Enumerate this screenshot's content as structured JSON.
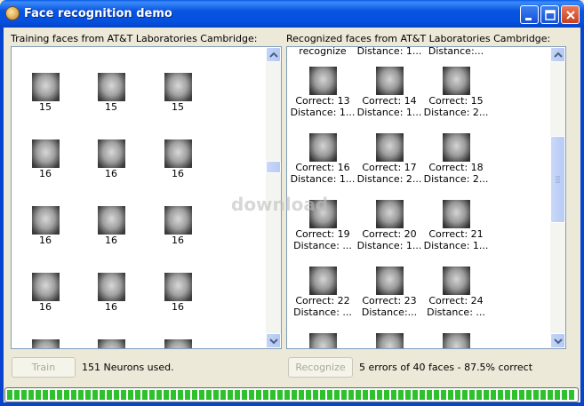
{
  "window": {
    "title": "Face recognition demo"
  },
  "training": {
    "label": "Training faces from AT&T Laboratories Cambridge:",
    "rows": [
      [
        "15",
        "15",
        "15"
      ],
      [
        "16",
        "16",
        "16"
      ],
      [
        "16",
        "16",
        "16"
      ],
      [
        "16",
        "16",
        "16"
      ],
      [
        "",
        "",
        ""
      ]
    ]
  },
  "recognized": {
    "label": "Recognized faces from AT&T Laboratories Cambridge:",
    "top_row": [
      [
        "recognize"
      ],
      [
        "Distance: 1..."
      ],
      [
        "Distance:..."
      ]
    ],
    "rows": [
      [
        [
          "Correct: 13",
          "Distance: 1..."
        ],
        [
          "Correct: 14",
          "Distance: 1..."
        ],
        [
          "Correct: 15",
          "Distance: 2..."
        ]
      ],
      [
        [
          "Correct: 16",
          "Distance: 1..."
        ],
        [
          "Correct: 17",
          "Distance: 2..."
        ],
        [
          "Correct: 18",
          "Distance: 2..."
        ]
      ],
      [
        [
          "Correct: 19",
          "Distance: ..."
        ],
        [
          "Correct: 20",
          "Distance: 1..."
        ],
        [
          "Correct: 21",
          "Distance: 1..."
        ]
      ],
      [
        [
          "Correct: 22",
          "Distance: ..."
        ],
        [
          "Correct: 23",
          "Distance:..."
        ],
        [
          "Correct: 24",
          "Distance: ..."
        ]
      ],
      [
        [
          ""
        ],
        [
          ""
        ],
        [
          ""
        ]
      ]
    ]
  },
  "train_button": {
    "label": "Train"
  },
  "train_status": "151 Neurons used.",
  "recognize_button": {
    "label": "Recognize"
  },
  "recognize_status": "5 errors of 40 faces - 87.5% correct",
  "progress": {
    "percent": 100
  },
  "watermark": "download",
  "colors": {
    "titlebar": "#0854e3",
    "progress": "#2ec12e",
    "panel_border": "#7f9db9"
  }
}
